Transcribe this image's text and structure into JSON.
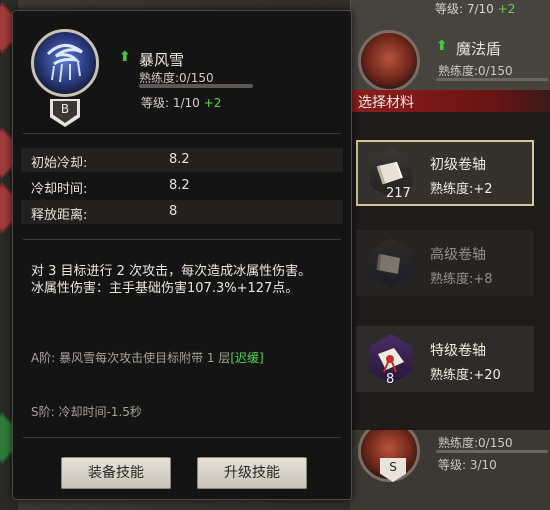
{
  "background": {
    "top_item": {
      "level_text": "等级: 7/10",
      "level_plus": "+2"
    },
    "right_item": {
      "name": "魔法盾",
      "exp": "熟练度:0/150"
    },
    "bottom_item": {
      "exp": "熟练度:0/150",
      "level": "等级: 3/10",
      "badge": "S"
    }
  },
  "skill": {
    "name": "暴风雪",
    "badge": "B",
    "exp_text": "熟练度:0/150",
    "exp_progress": 0.0,
    "level_text": "等级: 1/10",
    "level_plus": "+2",
    "stats": [
      {
        "label": "初始冷却:",
        "value": "8.2"
      },
      {
        "label": "冷却时间:",
        "value": "8.2"
      },
      {
        "label": "释放距离:",
        "value": "8"
      }
    ],
    "description_1": "对 3 目标进行 2 次攻击，每次造成冰属性伤害。",
    "description_2": "冰属性伤害：主手基础伤害107.3%+127点。",
    "tier_a_text": "A阶: 暴风雪每次攻击使目标附带 1 层",
    "tier_a_link": "[迟缓]",
    "tier_s_text": "S阶: 冷却时间-1.5秒"
  },
  "buttons": {
    "equip": "装备技能",
    "upgrade": "升级技能"
  },
  "materials": {
    "header": "选择材料",
    "items": [
      {
        "name": "初级卷轴",
        "exp": "熟练度:+2",
        "count": "217"
      },
      {
        "name": "高级卷轴",
        "exp": "熟练度:+8",
        "count": ""
      },
      {
        "name": "特级卷轴",
        "exp": "熟练度:+20",
        "count": "8"
      }
    ]
  },
  "colors": {
    "accent_green": "#3ecb4a",
    "header_red": "#8e1d1d",
    "selected_border": "#d7c79a"
  }
}
